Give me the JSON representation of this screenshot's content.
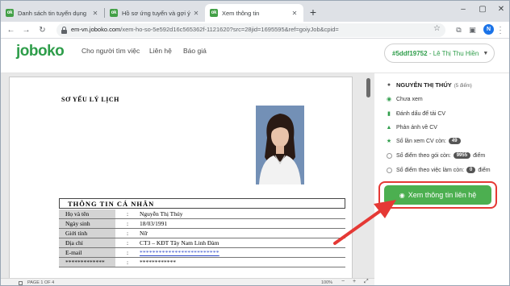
{
  "browser": {
    "tabs": [
      {
        "favicon": "ok",
        "label": "Danh sách tin tuyển dụng"
      },
      {
        "favicon": "ok",
        "label": "Hồ sơ ứng tuyển và gợi ý"
      },
      {
        "favicon": "ok",
        "label": "Xem thông tin"
      }
    ],
    "active_tab_index": 2,
    "new_tab_icon": "plus-icon",
    "address": {
      "host": "em-vn.joboko.com",
      "path": "/xem-ho-so-5e592d16c565362f-1121620?src=28jid=1695595&ref=goiyJob&cpid="
    },
    "profile_initial": "N"
  },
  "site": {
    "logo": "joboko",
    "nav": [
      "Cho người tìm việc",
      "Liên hệ",
      "Báo giá"
    ],
    "user_pill": {
      "id": "#5ddf19752",
      "separator": " - ",
      "name": "Lê Thị Thu Hiền"
    }
  },
  "cv": {
    "title": "SƠ YẾU LÝ LỊCH",
    "section_title": "THÔNG TIN CÁ NHÂN",
    "rows": [
      {
        "label": "Họ và tên",
        "value": "Nguyễn Thị Thúy"
      },
      {
        "label": "Ngày sinh",
        "value": "18/03/1991"
      },
      {
        "label": "Giới tính",
        "value": "Nữ"
      },
      {
        "label": "Địa chỉ",
        "value": "CT3 – KĐT Tây Nam Linh Đàm"
      },
      {
        "label": "E-mail",
        "value": "*************************"
      },
      {
        "label": "*************",
        "value": "************"
      }
    ],
    "pager": {
      "page": "PAGE 1 OF 4",
      "zoom": "100%"
    }
  },
  "panel": {
    "candidate_name": "NGUYỄN THỊ THÚY",
    "candidate_points": "(5 điểm)",
    "status": "Chưa xem",
    "mark_label": "Đánh dấu để tải CV",
    "report_label": "Phản ánh về CV",
    "views_label": "Số lần xem CV còn:",
    "views_count": "49",
    "points_plan_label": "Số điểm theo gói còn:",
    "points_plan_count": "9955",
    "points_plan_unit": "điểm",
    "points_job_label": "Số điểm theo việc làm còn:",
    "points_job_count": "0",
    "points_job_unit": "điểm",
    "cta_label": "Xem thông tin liên hệ"
  },
  "colors": {
    "brand_green": "#2e9d4a",
    "cta_green": "#4caf50",
    "highlight_red": "#e53935"
  }
}
